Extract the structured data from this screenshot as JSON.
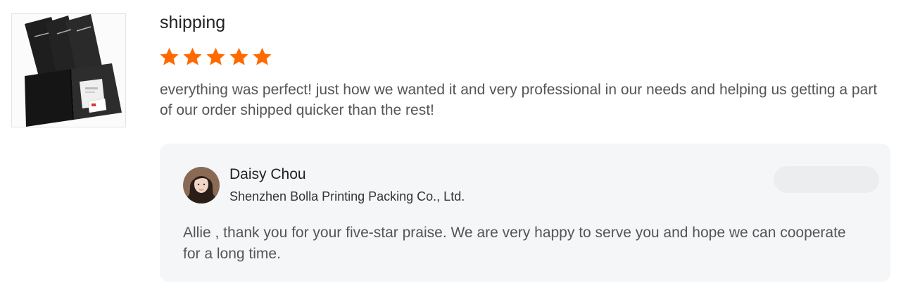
{
  "review": {
    "title": "shipping",
    "rating": 5,
    "rating_max": 5,
    "star_color": "#ff6a00",
    "comment": "everything was perfect! just how we wanted it and very professional in our needs and helping us getting a part of our order shipped quicker than the rest!",
    "product_image_icon": "product-folder-image"
  },
  "reply": {
    "name": "Daisy Chou",
    "company": "Shenzhen Bolla Printing Packing Co., Ltd.",
    "text": "Allie , thank you for your five-star praise. We are very happy to serve you and hope we can cooperate for a long time.",
    "background_color": "#f5f6f8",
    "avatar_icon": "person-avatar"
  }
}
